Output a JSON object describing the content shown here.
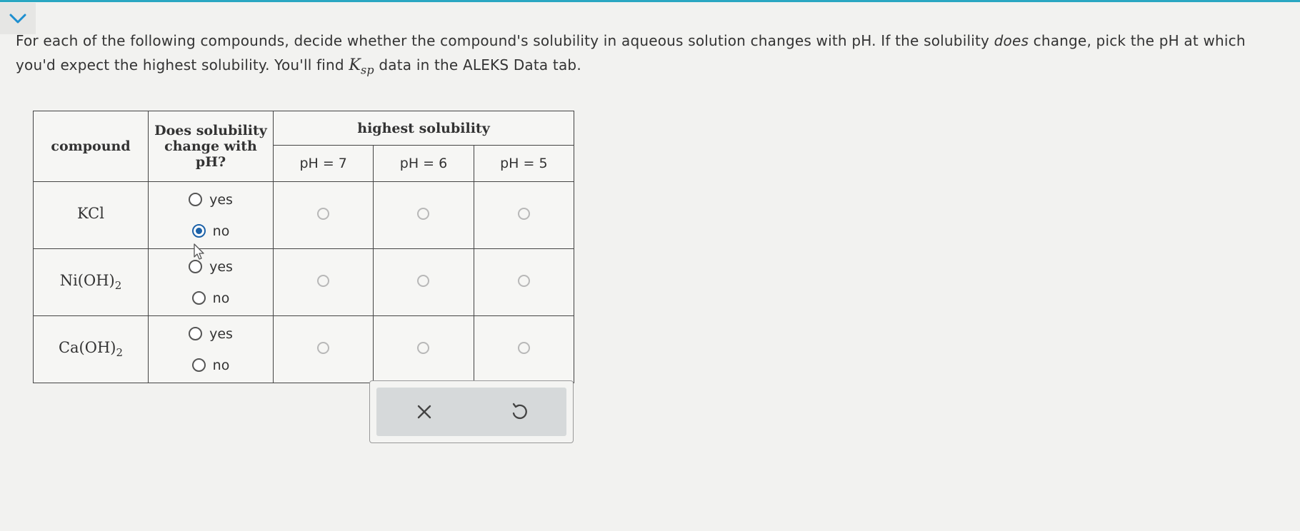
{
  "question": {
    "text_before_does": "For each of the following compounds, decide whether the compound's solubility in aqueous solution changes with pH. If the solubility ",
    "text_does": "does",
    "text_after_does": " change, pick the pH at which you'd expect the highest solubility. You'll find ",
    "ksp_K": "K",
    "ksp_sub": "sp",
    "text_end": " data in the ALEKS Data tab."
  },
  "table": {
    "header_compound": "compound",
    "header_change": "Does solubility change with pH?",
    "header_highest": "highest solubility",
    "ph_columns": [
      "pH = 7",
      "pH = 6",
      "pH = 5"
    ],
    "rows": [
      {
        "formula": "KCl",
        "formula_sub": "",
        "yes_label": "yes",
        "no_label": "no",
        "selected": "no"
      },
      {
        "formula": "Ni(OH)",
        "formula_sub": "2",
        "yes_label": "yes",
        "no_label": "no",
        "selected": ""
      },
      {
        "formula": "Ca(OH)",
        "formula_sub": "2",
        "yes_label": "yes",
        "no_label": "no",
        "selected": ""
      }
    ]
  },
  "icons": {
    "collapse": "chevron-down-icon",
    "clear": "x-icon",
    "undo": "undo-icon"
  },
  "colors": {
    "accent": "#2aa7c2",
    "radio_selected": "#1c62a8",
    "chevron": "#1d8fd0"
  }
}
